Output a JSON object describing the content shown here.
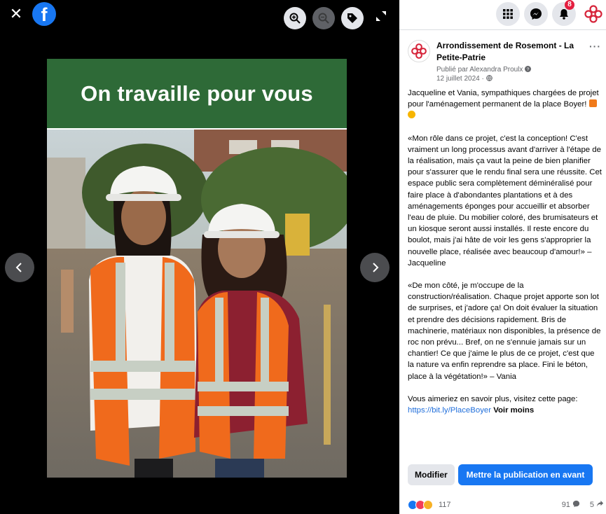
{
  "viewer": {
    "close_label": "✕",
    "logo_letter": "f",
    "banner_text": "On travaille pour vous"
  },
  "topbar": {
    "notification_count": "8"
  },
  "post": {
    "page_name": "Arrondissement de Rosemont - La Petite-Patrie",
    "published_by": "Publié par Alexandra Proulx",
    "date": "12 juillet 2024 ·",
    "paragraph_1": "Jacqueline et Vania, sympathiques chargées de projet pour l'aménagement permanent de la place Boyer!",
    "paragraph_2": "«Mon rôle dans ce projet, c'est la conception! C'est vraiment un long processus avant d'arriver à l'étape de la réalisation, mais ça vaut la peine de bien planifier pour s'assurer que le rendu final sera une réussite. Cet espace public sera complètement déminéralisé pour faire place à d'abondantes plantations et à des aménagements éponges pour accueillir et absorber l'eau de pluie. Du mobilier coloré, des brumisateurs et un kiosque seront aussi installés. Il reste encore du boulot, mais j'ai hâte de voir les gens s'approprier la nouvelle place, réalisée avec beaucoup d'amour!» – Jacqueline",
    "paragraph_3": "«De mon côté, je m'occupe de la construction/réalisation. Chaque projet apporte son lot de surprises, et j'adore ça! On doit évaluer la situation et prendre des décisions rapidement. Bris de machinerie, matériaux non disponibles, la présence de roc non prévu... Bref, on ne s'ennuie jamais sur un chantier! Ce que j'aime le plus de ce projet, c'est que la nature va enfin reprendre sa place. Fini le béton, place à la végétation!» – Vania",
    "paragraph_4_prefix": "Vous aimeriez en savoir plus, visitez cette page:",
    "link": "https://bit.ly/PlaceBoyer",
    "see_less": "Voir moins"
  },
  "actions": {
    "edit_label": "Modifier",
    "boost_label": "Mettre la publication en avant"
  },
  "stats": {
    "reactions": "117",
    "comments": "91",
    "shares": "5"
  },
  "colors": {
    "brand_blue": "#1877f2",
    "banner_green": "#2e6a37",
    "notification_red": "#e41e3f"
  }
}
